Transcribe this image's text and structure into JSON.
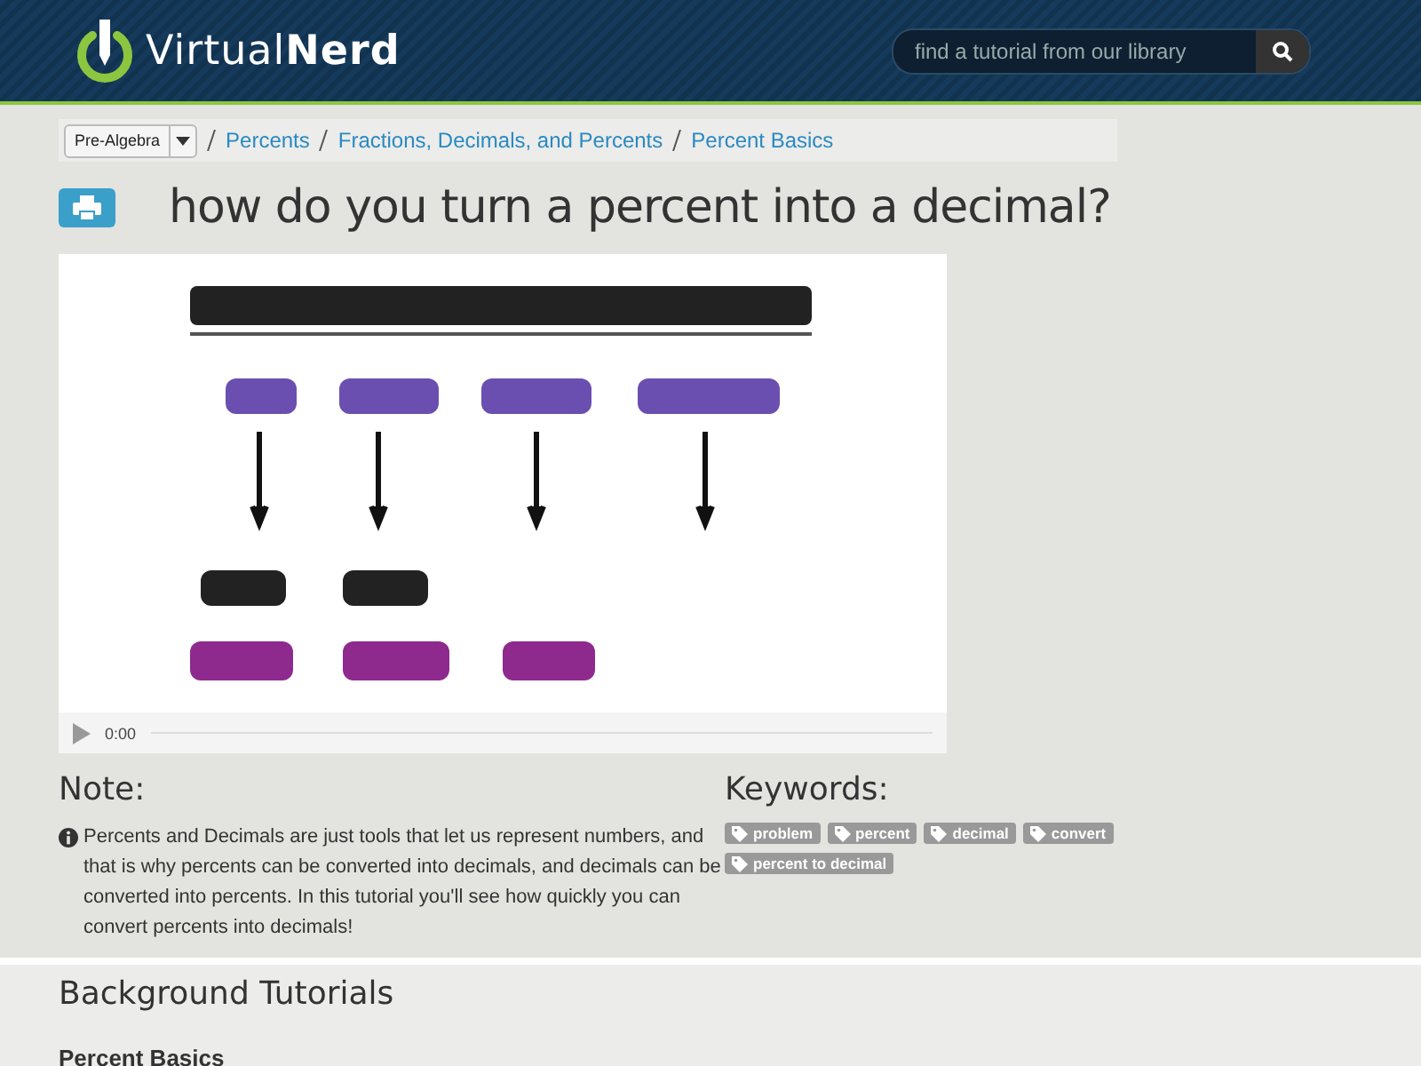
{
  "header": {
    "logo": "Virtual**Nerd**",
    "search": {
      "placeholder": "find a tutorial from our library"
    }
  },
  "breadcrumb": {
    "subject": "Pre-Algebra",
    "links": [
      "Percents",
      "Fractions, Decimals, and Percents",
      "Percent Basics"
    ]
  },
  "title": "how do you turn a percent into a decimal?",
  "video": {
    "time": "0:00"
  },
  "note": {
    "heading": "Note:",
    "text": "Percents and Decimals are just tools that let us represent numbers, and that is why percents can be converted into decimals, and decimals can be converted into percents. In this tutorial you'll see how quickly you can convert percents into decimals!"
  },
  "keywords": {
    "heading": "Keywords:",
    "tags": [
      "problem",
      "percent",
      "decimal",
      "convert",
      "percent to decimal"
    ]
  },
  "background": {
    "heading": "Background Tutorials",
    "items": [
      "Percent Basics"
    ]
  }
}
